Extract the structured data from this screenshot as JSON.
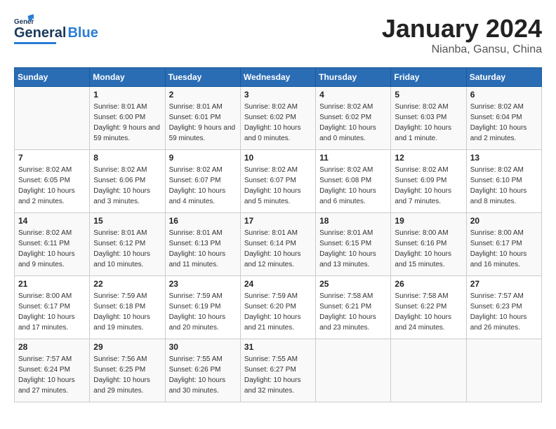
{
  "header": {
    "logo_line1": "General",
    "logo_line2": "Blue",
    "calendar_title": "January 2024",
    "calendar_subtitle": "Nianba, Gansu, China"
  },
  "weekdays": [
    "Sunday",
    "Monday",
    "Tuesday",
    "Wednesday",
    "Thursday",
    "Friday",
    "Saturday"
  ],
  "weeks": [
    [
      {
        "day": "",
        "sunrise": "",
        "sunset": "",
        "daylight": ""
      },
      {
        "day": "1",
        "sunrise": "Sunrise: 8:01 AM",
        "sunset": "Sunset: 6:00 PM",
        "daylight": "Daylight: 9 hours and 59 minutes."
      },
      {
        "day": "2",
        "sunrise": "Sunrise: 8:01 AM",
        "sunset": "Sunset: 6:01 PM",
        "daylight": "Daylight: 9 hours and 59 minutes."
      },
      {
        "day": "3",
        "sunrise": "Sunrise: 8:02 AM",
        "sunset": "Sunset: 6:02 PM",
        "daylight": "Daylight: 10 hours and 0 minutes."
      },
      {
        "day": "4",
        "sunrise": "Sunrise: 8:02 AM",
        "sunset": "Sunset: 6:02 PM",
        "daylight": "Daylight: 10 hours and 0 minutes."
      },
      {
        "day": "5",
        "sunrise": "Sunrise: 8:02 AM",
        "sunset": "Sunset: 6:03 PM",
        "daylight": "Daylight: 10 hours and 1 minute."
      },
      {
        "day": "6",
        "sunrise": "Sunrise: 8:02 AM",
        "sunset": "Sunset: 6:04 PM",
        "daylight": "Daylight: 10 hours and 2 minutes."
      }
    ],
    [
      {
        "day": "7",
        "sunrise": "Sunrise: 8:02 AM",
        "sunset": "Sunset: 6:05 PM",
        "daylight": "Daylight: 10 hours and 2 minutes."
      },
      {
        "day": "8",
        "sunrise": "Sunrise: 8:02 AM",
        "sunset": "Sunset: 6:06 PM",
        "daylight": "Daylight: 10 hours and 3 minutes."
      },
      {
        "day": "9",
        "sunrise": "Sunrise: 8:02 AM",
        "sunset": "Sunset: 6:07 PM",
        "daylight": "Daylight: 10 hours and 4 minutes."
      },
      {
        "day": "10",
        "sunrise": "Sunrise: 8:02 AM",
        "sunset": "Sunset: 6:07 PM",
        "daylight": "Daylight: 10 hours and 5 minutes."
      },
      {
        "day": "11",
        "sunrise": "Sunrise: 8:02 AM",
        "sunset": "Sunset: 6:08 PM",
        "daylight": "Daylight: 10 hours and 6 minutes."
      },
      {
        "day": "12",
        "sunrise": "Sunrise: 8:02 AM",
        "sunset": "Sunset: 6:09 PM",
        "daylight": "Daylight: 10 hours and 7 minutes."
      },
      {
        "day": "13",
        "sunrise": "Sunrise: 8:02 AM",
        "sunset": "Sunset: 6:10 PM",
        "daylight": "Daylight: 10 hours and 8 minutes."
      }
    ],
    [
      {
        "day": "14",
        "sunrise": "Sunrise: 8:02 AM",
        "sunset": "Sunset: 6:11 PM",
        "daylight": "Daylight: 10 hours and 9 minutes."
      },
      {
        "day": "15",
        "sunrise": "Sunrise: 8:01 AM",
        "sunset": "Sunset: 6:12 PM",
        "daylight": "Daylight: 10 hours and 10 minutes."
      },
      {
        "day": "16",
        "sunrise": "Sunrise: 8:01 AM",
        "sunset": "Sunset: 6:13 PM",
        "daylight": "Daylight: 10 hours and 11 minutes."
      },
      {
        "day": "17",
        "sunrise": "Sunrise: 8:01 AM",
        "sunset": "Sunset: 6:14 PM",
        "daylight": "Daylight: 10 hours and 12 minutes."
      },
      {
        "day": "18",
        "sunrise": "Sunrise: 8:01 AM",
        "sunset": "Sunset: 6:15 PM",
        "daylight": "Daylight: 10 hours and 13 minutes."
      },
      {
        "day": "19",
        "sunrise": "Sunrise: 8:00 AM",
        "sunset": "Sunset: 6:16 PM",
        "daylight": "Daylight: 10 hours and 15 minutes."
      },
      {
        "day": "20",
        "sunrise": "Sunrise: 8:00 AM",
        "sunset": "Sunset: 6:17 PM",
        "daylight": "Daylight: 10 hours and 16 minutes."
      }
    ],
    [
      {
        "day": "21",
        "sunrise": "Sunrise: 8:00 AM",
        "sunset": "Sunset: 6:17 PM",
        "daylight": "Daylight: 10 hours and 17 minutes."
      },
      {
        "day": "22",
        "sunrise": "Sunrise: 7:59 AM",
        "sunset": "Sunset: 6:18 PM",
        "daylight": "Daylight: 10 hours and 19 minutes."
      },
      {
        "day": "23",
        "sunrise": "Sunrise: 7:59 AM",
        "sunset": "Sunset: 6:19 PM",
        "daylight": "Daylight: 10 hours and 20 minutes."
      },
      {
        "day": "24",
        "sunrise": "Sunrise: 7:59 AM",
        "sunset": "Sunset: 6:20 PM",
        "daylight": "Daylight: 10 hours and 21 minutes."
      },
      {
        "day": "25",
        "sunrise": "Sunrise: 7:58 AM",
        "sunset": "Sunset: 6:21 PM",
        "daylight": "Daylight: 10 hours and 23 minutes."
      },
      {
        "day": "26",
        "sunrise": "Sunrise: 7:58 AM",
        "sunset": "Sunset: 6:22 PM",
        "daylight": "Daylight: 10 hours and 24 minutes."
      },
      {
        "day": "27",
        "sunrise": "Sunrise: 7:57 AM",
        "sunset": "Sunset: 6:23 PM",
        "daylight": "Daylight: 10 hours and 26 minutes."
      }
    ],
    [
      {
        "day": "28",
        "sunrise": "Sunrise: 7:57 AM",
        "sunset": "Sunset: 6:24 PM",
        "daylight": "Daylight: 10 hours and 27 minutes."
      },
      {
        "day": "29",
        "sunrise": "Sunrise: 7:56 AM",
        "sunset": "Sunset: 6:25 PM",
        "daylight": "Daylight: 10 hours and 29 minutes."
      },
      {
        "day": "30",
        "sunrise": "Sunrise: 7:55 AM",
        "sunset": "Sunset: 6:26 PM",
        "daylight": "Daylight: 10 hours and 30 minutes."
      },
      {
        "day": "31",
        "sunrise": "Sunrise: 7:55 AM",
        "sunset": "Sunset: 6:27 PM",
        "daylight": "Daylight: 10 hours and 32 minutes."
      },
      {
        "day": "",
        "sunrise": "",
        "sunset": "",
        "daylight": ""
      },
      {
        "day": "",
        "sunrise": "",
        "sunset": "",
        "daylight": ""
      },
      {
        "day": "",
        "sunrise": "",
        "sunset": "",
        "daylight": ""
      }
    ]
  ]
}
